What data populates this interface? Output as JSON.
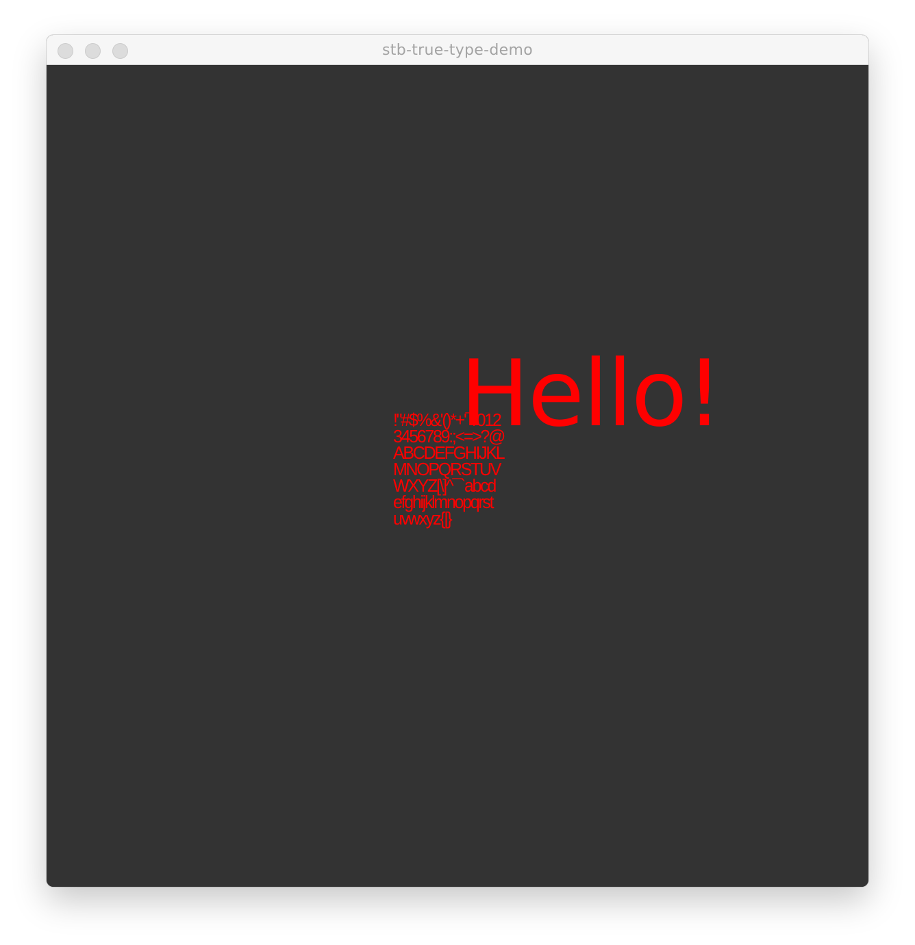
{
  "window": {
    "title": "stb-true-type-demo",
    "controls": [
      "close",
      "minimize",
      "zoom"
    ]
  },
  "canvas": {
    "background": "#333333",
    "text_color": "#ff0000",
    "hello_text": "Hello!",
    "glyph_rows": [
      "!\"#$%&'()*+'¯/012",
      "3456789:;<=>?@",
      "ABCDEFGHIJKL",
      "MNOPQRSTUV",
      "WXYZ[\\]^¯`abcd",
      "efghijklmnopqrst",
      "uvwxyz{|}"
    ]
  }
}
